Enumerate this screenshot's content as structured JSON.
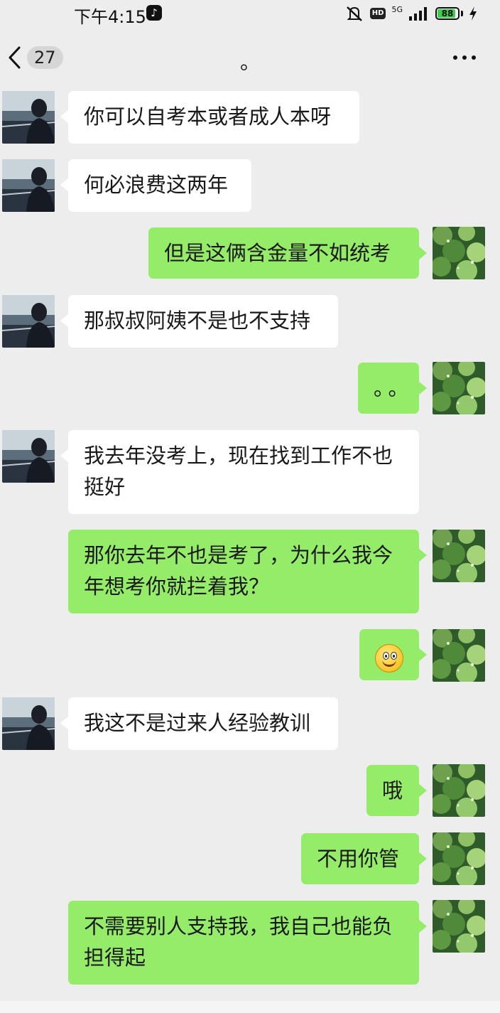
{
  "status_bar": {
    "time": "下午4:15",
    "tiktok_icon": "tiktok-icon",
    "network": "5G",
    "hd": "HD",
    "battery": "88",
    "battery_level": 0.88
  },
  "header": {
    "unread_count": "27",
    "title": "。"
  },
  "messages": [
    {
      "side": "left",
      "text": "你可以自考本或者成人本呀"
    },
    {
      "side": "left",
      "text": "何必浪费这两年"
    },
    {
      "side": "right",
      "text": "但是这俩含金量不如统考"
    },
    {
      "side": "left",
      "text": "那叔叔阿姨不是也不支持"
    },
    {
      "side": "right",
      "text": "。。"
    },
    {
      "side": "left",
      "text": "我去年没考上，现在找到工作不也挺好"
    },
    {
      "side": "right",
      "text": "那你去年不也是考了，为什么我今年想考你就拦着我？"
    },
    {
      "side": "right",
      "emoji": "smile-emoji"
    },
    {
      "side": "left",
      "text": "我这不是过来人经验教训"
    },
    {
      "side": "right",
      "text": "哦"
    },
    {
      "side": "right",
      "text": "不用你管"
    },
    {
      "side": "right",
      "text": "不需要别人支持我，我自己也能负担得起"
    }
  ],
  "colors": {
    "background": "#ededed",
    "bubble_self": "#95ec69",
    "bubble_other": "#ffffff",
    "text": "#191919"
  }
}
